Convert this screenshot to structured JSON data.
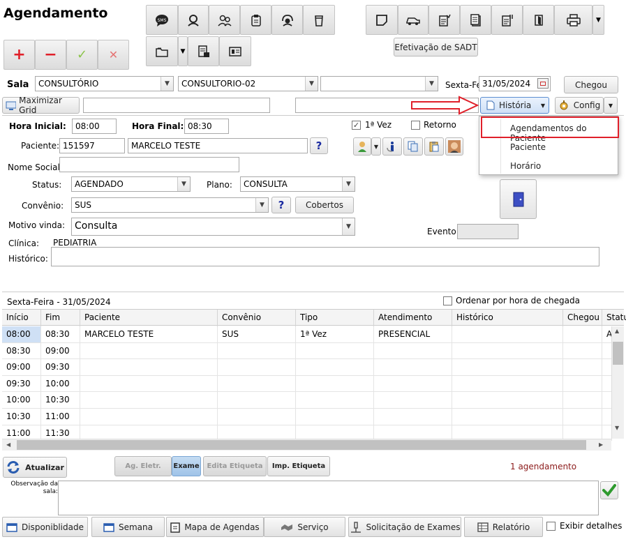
{
  "title": "Agendamento",
  "toolbar": {
    "sadt_label": "Efetivação de SADT",
    "chegou_label": "Chegou",
    "maximizar_label": "Maximizar Grid",
    "historia_label": "História",
    "config_label": "Config"
  },
  "sala": {
    "label": "Sala",
    "sala1": "CONSULTÓRIO",
    "sala2": "CONSULTORIO-02",
    "sala3": "",
    "date_label": "Sexta-Fei",
    "date_value": "31/05/2024"
  },
  "menu": {
    "items": [
      "Agendamentos do Paciente",
      "Paciente",
      "Horário"
    ]
  },
  "form": {
    "hora_inicial_label": "Hora Inicial:",
    "hora_inicial": "08:00",
    "hora_final_label": "Hora Final:",
    "hora_final": "08:30",
    "primeira_vez_label": "1ª Vez",
    "retorno_label": "Retorno",
    "paciente_label": "Paciente:",
    "paciente_id": "151597",
    "paciente_nome": "MARCELO TESTE",
    "nome_social_label": "Nome Social:",
    "nome_social": "",
    "status_label": "Status:",
    "status": "AGENDADO",
    "plano_label": "Plano:",
    "plano": "CONSULTA",
    "convenio_label": "Convênio:",
    "convenio": "SUS",
    "cobertos_label": "Cobertos",
    "motivo_label": "Motivo vinda:",
    "motivo": "Consulta",
    "evento_label": "Evento:",
    "clinica_label": "Clínica:",
    "clinica": "PEDIATRIA",
    "historico_label": "Histórico:"
  },
  "grid": {
    "date_title": "Sexta-Feira - 31/05/2024",
    "ordenar_label": "Ordenar por hora de chegada",
    "columns": [
      "Início",
      "Fim",
      "Paciente",
      "Convênio",
      "Tipo",
      "Atendimento",
      "Histórico",
      "Chegou",
      "Statu"
    ],
    "rows": [
      [
        "08:00",
        "08:30",
        "MARCELO TESTE",
        "SUS",
        "1ª Vez",
        "PRESENCIAL",
        "",
        "",
        "A"
      ],
      [
        "08:30",
        "09:00",
        "",
        "",
        "",
        "",
        "",
        "",
        ""
      ],
      [
        "09:00",
        "09:30",
        "",
        "",
        "",
        "",
        "",
        "",
        ""
      ],
      [
        "09:30",
        "10:00",
        "",
        "",
        "",
        "",
        "",
        "",
        ""
      ],
      [
        "10:00",
        "10:30",
        "",
        "",
        "",
        "",
        "",
        "",
        ""
      ],
      [
        "10:30",
        "11:00",
        "",
        "",
        "",
        "",
        "",
        "",
        ""
      ],
      [
        "11:00",
        "11:30",
        "",
        "",
        "",
        "",
        "",
        "",
        ""
      ]
    ]
  },
  "actions": {
    "atualizar": "Atualizar",
    "ag_eletr": "Ag. Eletr.",
    "exame": "Exame",
    "edita_etiqueta": "Edita Etiqueta",
    "imp_etiqueta": "Imp. Etiqueta",
    "count": "1 agendamento",
    "obs_label": "Observação da sala:"
  },
  "tabs": {
    "disponibilidade": "Disponiblidade",
    "semana": "Semana",
    "mapa": "Mapa de Agendas",
    "servico": "Serviço",
    "solicitacao": "Solicitação de Exames",
    "relatorio": "Relatório",
    "exibir": "Exibir detalhes"
  },
  "colors": {
    "accent_red": "#e0202a",
    "selected_row": "#cfe0f5",
    "count_text": "#8b1a1a",
    "exame_active": "#a9cbea"
  }
}
